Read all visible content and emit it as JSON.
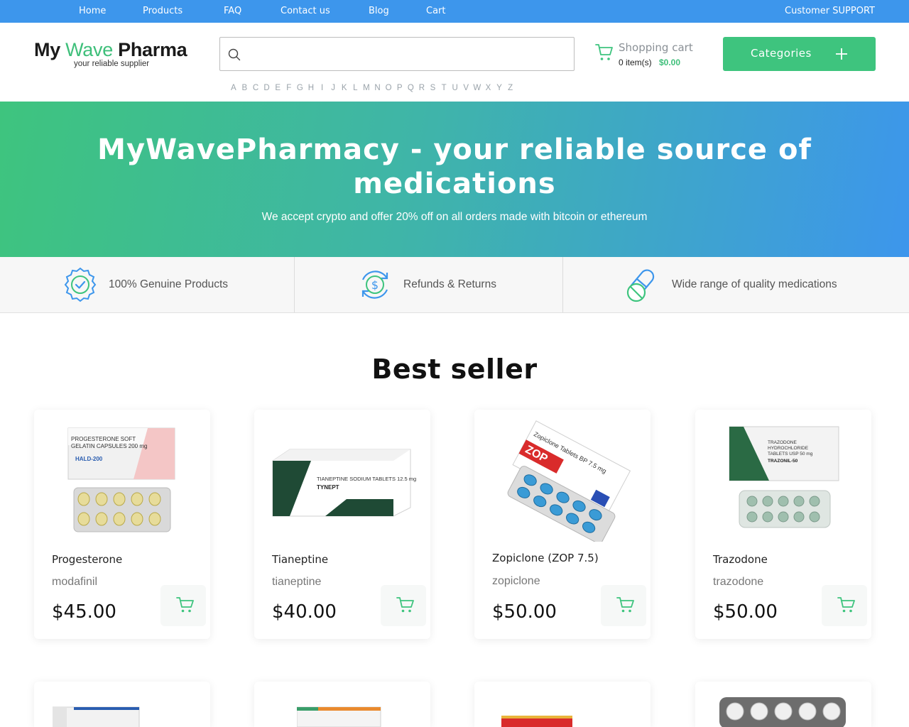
{
  "topnav": {
    "links": [
      "Home",
      "Products",
      "FAQ",
      "Contact us",
      "Blog",
      "Cart"
    ],
    "support": "Customer SUPPORT"
  },
  "logo": {
    "part1": "My ",
    "part2": "Wave",
    "part3": " Pharma",
    "tagline": "your reliable supplier"
  },
  "search": {
    "value": "",
    "placeholder": ""
  },
  "alphabet": [
    "A",
    "B",
    "C",
    "D",
    "E",
    "F",
    "G",
    "H",
    "I",
    "J",
    "K",
    "L",
    "M",
    "N",
    "O",
    "P",
    "Q",
    "R",
    "S",
    "T",
    "U",
    "V",
    "W",
    "X",
    "Y",
    "Z"
  ],
  "cart": {
    "title": "Shopping cart",
    "items": "0 item(s)",
    "total": "$0.00"
  },
  "categories": {
    "label": "Categories"
  },
  "hero": {
    "title": "MyWavePharmacy - your reliable source of medications",
    "subtitle": "We accept crypto and offer 20% off on all orders made with bitcoin or ethereum"
  },
  "features": [
    {
      "label": "100% Genuine Products",
      "icon": "badge-check-icon"
    },
    {
      "label": "Refunds & Returns",
      "icon": "refund-dollar-icon"
    },
    {
      "label": "Wide range of quality medications",
      "icon": "pill-capsule-icon"
    }
  ],
  "best_seller": {
    "title": "Best seller",
    "products": [
      {
        "name": "Progesterone",
        "generic": "modafinil",
        "price": "$45.00",
        "img_text": "PROGESTERONE SOFT GELATIN CAPSULES 200 mg",
        "brand": "HALD-200"
      },
      {
        "name": "Tianeptine",
        "generic": "tianeptine",
        "price": "$40.00",
        "img_text": "TIANEPTINE SODIUM TABLETS 12.5 mg",
        "brand": "TYNEPT"
      },
      {
        "name": "Zopiclone (ZOP 7.5)",
        "generic": "zopiclone",
        "price": "$50.00",
        "img_text": "Zopiclone Tablets BP 7.5 mg",
        "brand": "ZOP"
      },
      {
        "name": "Trazodone",
        "generic": "trazodone",
        "price": "$50.00",
        "img_text": "TRAZODONE HYDROCHLORIDE TABLETS USP 50 mg",
        "brand": "TRAZONIL-50"
      }
    ]
  },
  "colors": {
    "nav_blue": "#3d96ec",
    "brand_green": "#3ec47e",
    "teal": "#3fb5a8"
  }
}
